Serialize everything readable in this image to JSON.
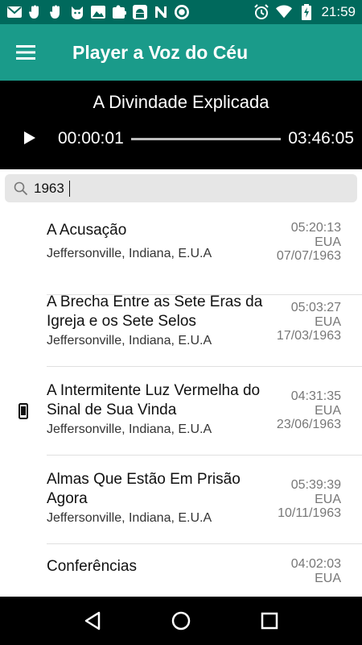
{
  "status_bar": {
    "time": "21:59",
    "icons": [
      "mail-icon",
      "hand-icon",
      "hand-icon",
      "cat-icon",
      "image-icon",
      "puzzle-icon",
      "android-icon",
      "n-icon",
      "circle-icon",
      "alarm-icon",
      "wifi-icon",
      "battery-charging-icon"
    ]
  },
  "app_bar": {
    "title": "Player a Voz do Céu"
  },
  "player": {
    "track_title": "A Divindade Explicada",
    "current_time": "00:00:01",
    "total_time": "03:46:05",
    "progress": 0.0
  },
  "search": {
    "value": "1963",
    "placeholder": ""
  },
  "list": {
    "items": [
      {
        "title": "A Acusação",
        "subtitle": "Jeffersonville, Indiana, E.U.A",
        "duration": "05:20:13",
        "country": "EUA",
        "date": "07/07/1963",
        "has_device_icon": false
      },
      {
        "title": "A Brecha Entre as Sete Eras da Igreja e os Sete Selos",
        "subtitle": "Jeffersonville, Indiana, E.U.A",
        "duration": "05:03:27",
        "country": "EUA",
        "date": "17/03/1963",
        "has_device_icon": false
      },
      {
        "title": "A Intermitente Luz Vermelha do Sinal de Sua Vinda",
        "subtitle": "Jeffersonville, Indiana, E.U.A",
        "duration": "04:31:35",
        "country": "EUA",
        "date": "23/06/1963",
        "has_device_icon": true
      },
      {
        "title": "Almas Que Estão Em Prisão Agora",
        "subtitle": "Jeffersonville, Indiana, E.U.A",
        "duration": "05:39:39",
        "country": "EUA",
        "date": "10/11/1963",
        "has_device_icon": false
      },
      {
        "title": "Conferências",
        "subtitle": "",
        "duration": "04:02:03",
        "country": "EUA",
        "date": "",
        "has_device_icon": false
      }
    ]
  },
  "colors": {
    "status_bar": "#00695c",
    "app_bar": "#1a9b8a",
    "player_bg": "#000000"
  }
}
